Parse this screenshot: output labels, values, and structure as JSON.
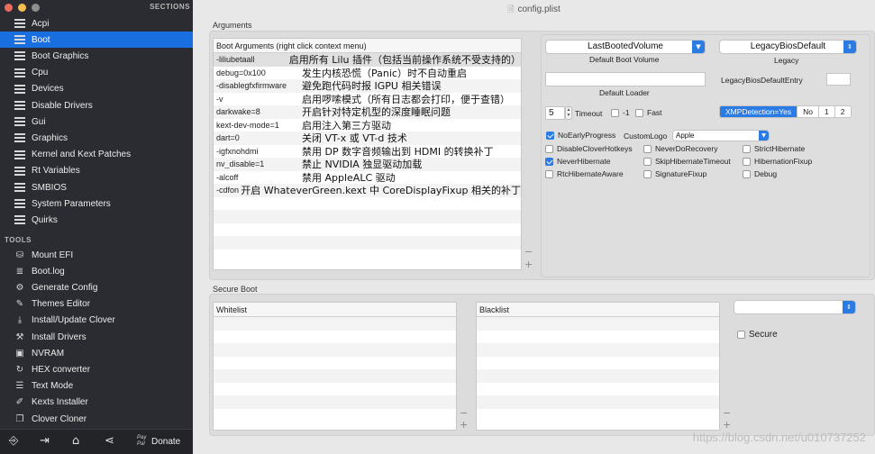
{
  "sidebar": {
    "sections_header": "SECTIONS",
    "items": [
      {
        "label": "Acpi",
        "icon": "list-icon"
      },
      {
        "label": "Boot",
        "icon": "list-icon",
        "selected": true
      },
      {
        "label": "Boot Graphics",
        "icon": "list-icon"
      },
      {
        "label": "Cpu",
        "icon": "list-icon"
      },
      {
        "label": "Devices",
        "icon": "list-icon"
      },
      {
        "label": "Disable Drivers",
        "icon": "list-icon"
      },
      {
        "label": "Gui",
        "icon": "list-icon"
      },
      {
        "label": "Graphics",
        "icon": "list-icon"
      },
      {
        "label": "Kernel and Kext Patches",
        "icon": "list-icon"
      },
      {
        "label": "Rt Variables",
        "icon": "list-icon"
      },
      {
        "label": "SMBIOS",
        "icon": "list-icon"
      },
      {
        "label": "System Parameters",
        "icon": "list-icon"
      },
      {
        "label": "Quirks",
        "icon": "list-icon"
      }
    ],
    "tools_header": "TOOLS",
    "tools": [
      {
        "label": "Mount EFI",
        "icon": "disk-icon"
      },
      {
        "label": "Boot.log",
        "icon": "log-icon"
      },
      {
        "label": "Generate Config",
        "icon": "gears-icon"
      },
      {
        "label": "Themes Editor",
        "icon": "palette-icon"
      },
      {
        "label": "Install/Update Clover",
        "icon": "download-icon"
      },
      {
        "label": "Install Drivers",
        "icon": "tools-icon"
      },
      {
        "label": "NVRAM",
        "icon": "chip-icon"
      },
      {
        "label": "HEX converter",
        "icon": "refresh-icon"
      },
      {
        "label": "Text Mode",
        "icon": "text-icon"
      },
      {
        "label": "Kexts Installer",
        "icon": "pen-icon"
      },
      {
        "label": "Clover Cloner",
        "icon": "copy-icon"
      }
    ],
    "bottom": {
      "donate_label": "Donate",
      "pay_label": "Pay Pal"
    }
  },
  "window": {
    "title": "config.plist"
  },
  "arguments": {
    "group_title": "Arguments",
    "table_header": "Boot Arguments (right click context menu)",
    "rows": [
      {
        "key": "-liliubetaall",
        "desc": "启用所有 Lilu 插件（包括当前操作系统不受支持的）"
      },
      {
        "key": "debug=0x100",
        "desc": "发生内核恐慌（Panic）时不自动重启"
      },
      {
        "key": "-disablegfxfirmware",
        "desc": "避免跑代码时报 IGPU 相关错误"
      },
      {
        "key": "-v",
        "desc": "启用啰嗦模式（所有日志都会打印，便于查错）"
      },
      {
        "key": "darkwake=8",
        "desc": "开启针对特定机型的深度睡眠问题"
      },
      {
        "key": "kext-dev-mode=1",
        "desc": "启用注入第三方驱动"
      },
      {
        "key": "dart=0",
        "desc": "关闭 VT-x 或 VT-d 技术"
      },
      {
        "key": "-igfxnohdmi",
        "desc": "禁用 DP 数字音频输出到 HDMI 的转换补丁"
      },
      {
        "key": "nv_disable=1",
        "desc": "禁止 NVIDIA 独显驱动加载"
      },
      {
        "key": "-alcoff",
        "desc": "禁用 AppleALC 驱动"
      },
      {
        "key": "-cdfon",
        "desc": "开启 WhateverGreen.kext 中 CoreDisplayFixup 相关的补丁"
      }
    ]
  },
  "options": {
    "default_boot_volume_value": "LastBootedVolume",
    "default_boot_volume_label": "Default Boot Volume",
    "legacy_value": "LegacyBiosDefault",
    "legacy_label": "Legacy",
    "default_loader_label": "Default Loader",
    "legacy_entry_label": "LegacyBiosDefaultEntry",
    "timeout_value": "5",
    "timeout_label": "Timeout",
    "minus_one_label": "-1",
    "fast_label": "Fast",
    "xmp_segments": [
      "XMPDetection=Yes",
      "No",
      "1",
      "2"
    ],
    "no_early_progress": "NoEarlyProgress",
    "custom_logo_label": "CustomLogo",
    "custom_logo_value": "Apple",
    "checks": [
      {
        "label": "DisableCloverHotkeys",
        "checked": false
      },
      {
        "label": "NeverDoRecovery",
        "checked": false
      },
      {
        "label": "StrictHibernate",
        "checked": false
      },
      {
        "label": "NeverHibernate",
        "checked": true
      },
      {
        "label": "SkipHibernateTimeout",
        "checked": false
      },
      {
        "label": "HibernationFixup",
        "checked": false
      },
      {
        "label": "RtcHibernateAware",
        "checked": false
      },
      {
        "label": "SignatureFixup",
        "checked": false
      },
      {
        "label": "Debug",
        "checked": false
      }
    ]
  },
  "secure_boot": {
    "group_title": "Secure Boot",
    "whitelist_header": "Whitelist",
    "blacklist_header": "Blacklist",
    "secure_label": "Secure"
  },
  "watermark": "https://blog.csdn.net/u010737252",
  "colors": {
    "accent": "#2a7be4",
    "sidebar_bg": "#2b2c31",
    "selected": "#1a6fe0"
  }
}
